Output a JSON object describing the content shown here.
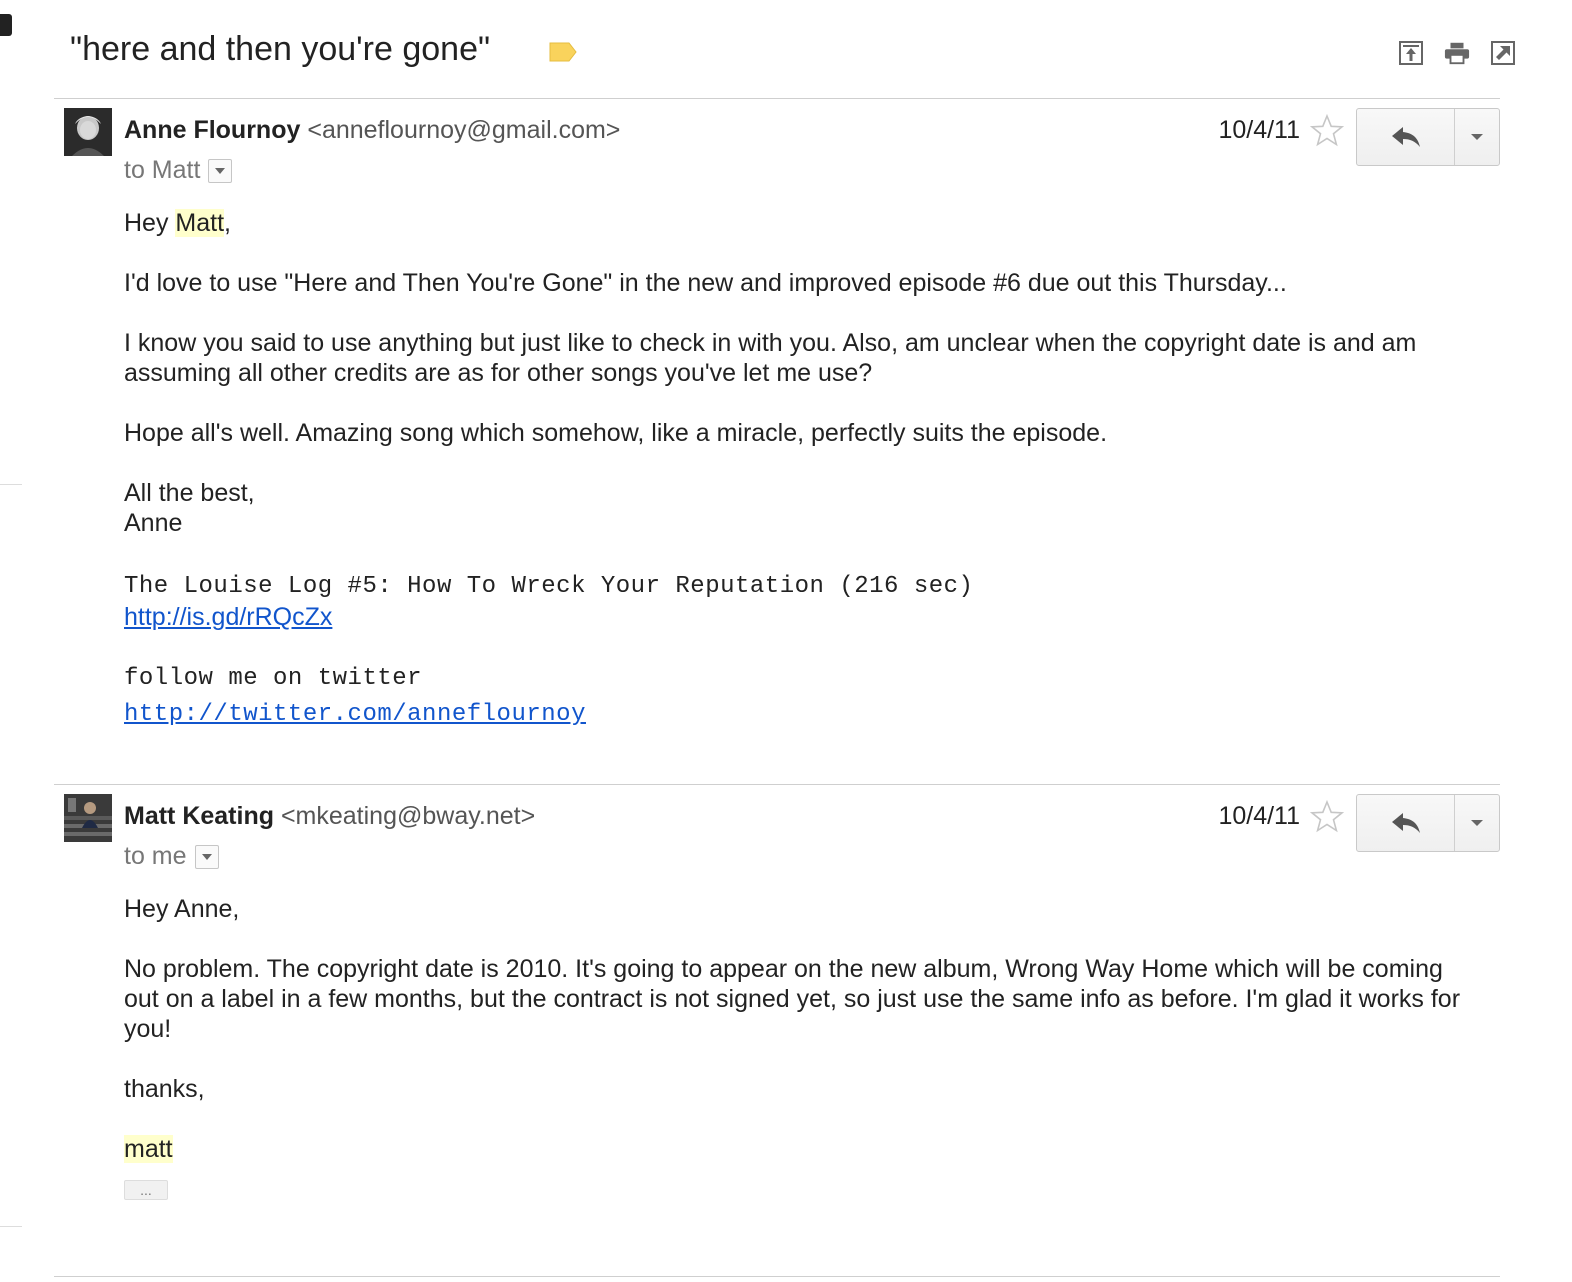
{
  "thread": {
    "subject": "\"here and then you're gone\"",
    "label_color": "#f9d35c",
    "actions": [
      "expand-all-icon",
      "print-icon",
      "new-window-icon"
    ]
  },
  "messages": [
    {
      "sender_name": "Anne Flournoy",
      "sender_email": "<anneflournoy@gmail.com>",
      "to": "to Matt",
      "date": "10/4/11",
      "greeting_pre": "Hey ",
      "greeting_name": "Matt",
      "greeting_post": ",",
      "p1": "I'd love to use \"Here and Then You're Gone\"  in the new and improved episode #6 due out this Thursday...",
      "p2": "I know you said to use anything but just like to check in with you.  Also, am unclear when the copyright date is and am assuming all other credits are as for other songs you've let me use?",
      "p3": "Hope all's well.  Amazing song which somehow, like a miracle, perfectly suits the episode.",
      "signoff": "All the best,",
      "signature": "Anne",
      "sig_title": "The Louise Log #5: How To Wreck Your Reputation (216 sec)",
      "sig_link": "http://is.gd/rRQcZx",
      "sig_follow": "follow me on twitter",
      "sig_twitter": "http://twitter.com/anneflournoy"
    },
    {
      "sender_name": "Matt Keating",
      "sender_email": "<mkeating@bway.net>",
      "to": "to me",
      "date": "10/4/11",
      "greeting": "Hey Anne,",
      "p1": "No problem.  The copyright date is 2010.  It's going to appear on the new album, Wrong Way Home which will be coming out on a label in a few months, but the contract is not signed yet, so just use the same info as before.  I'm glad it works for you!",
      "signoff": "thanks,",
      "signature": "matt",
      "trimmed": "..."
    }
  ]
}
